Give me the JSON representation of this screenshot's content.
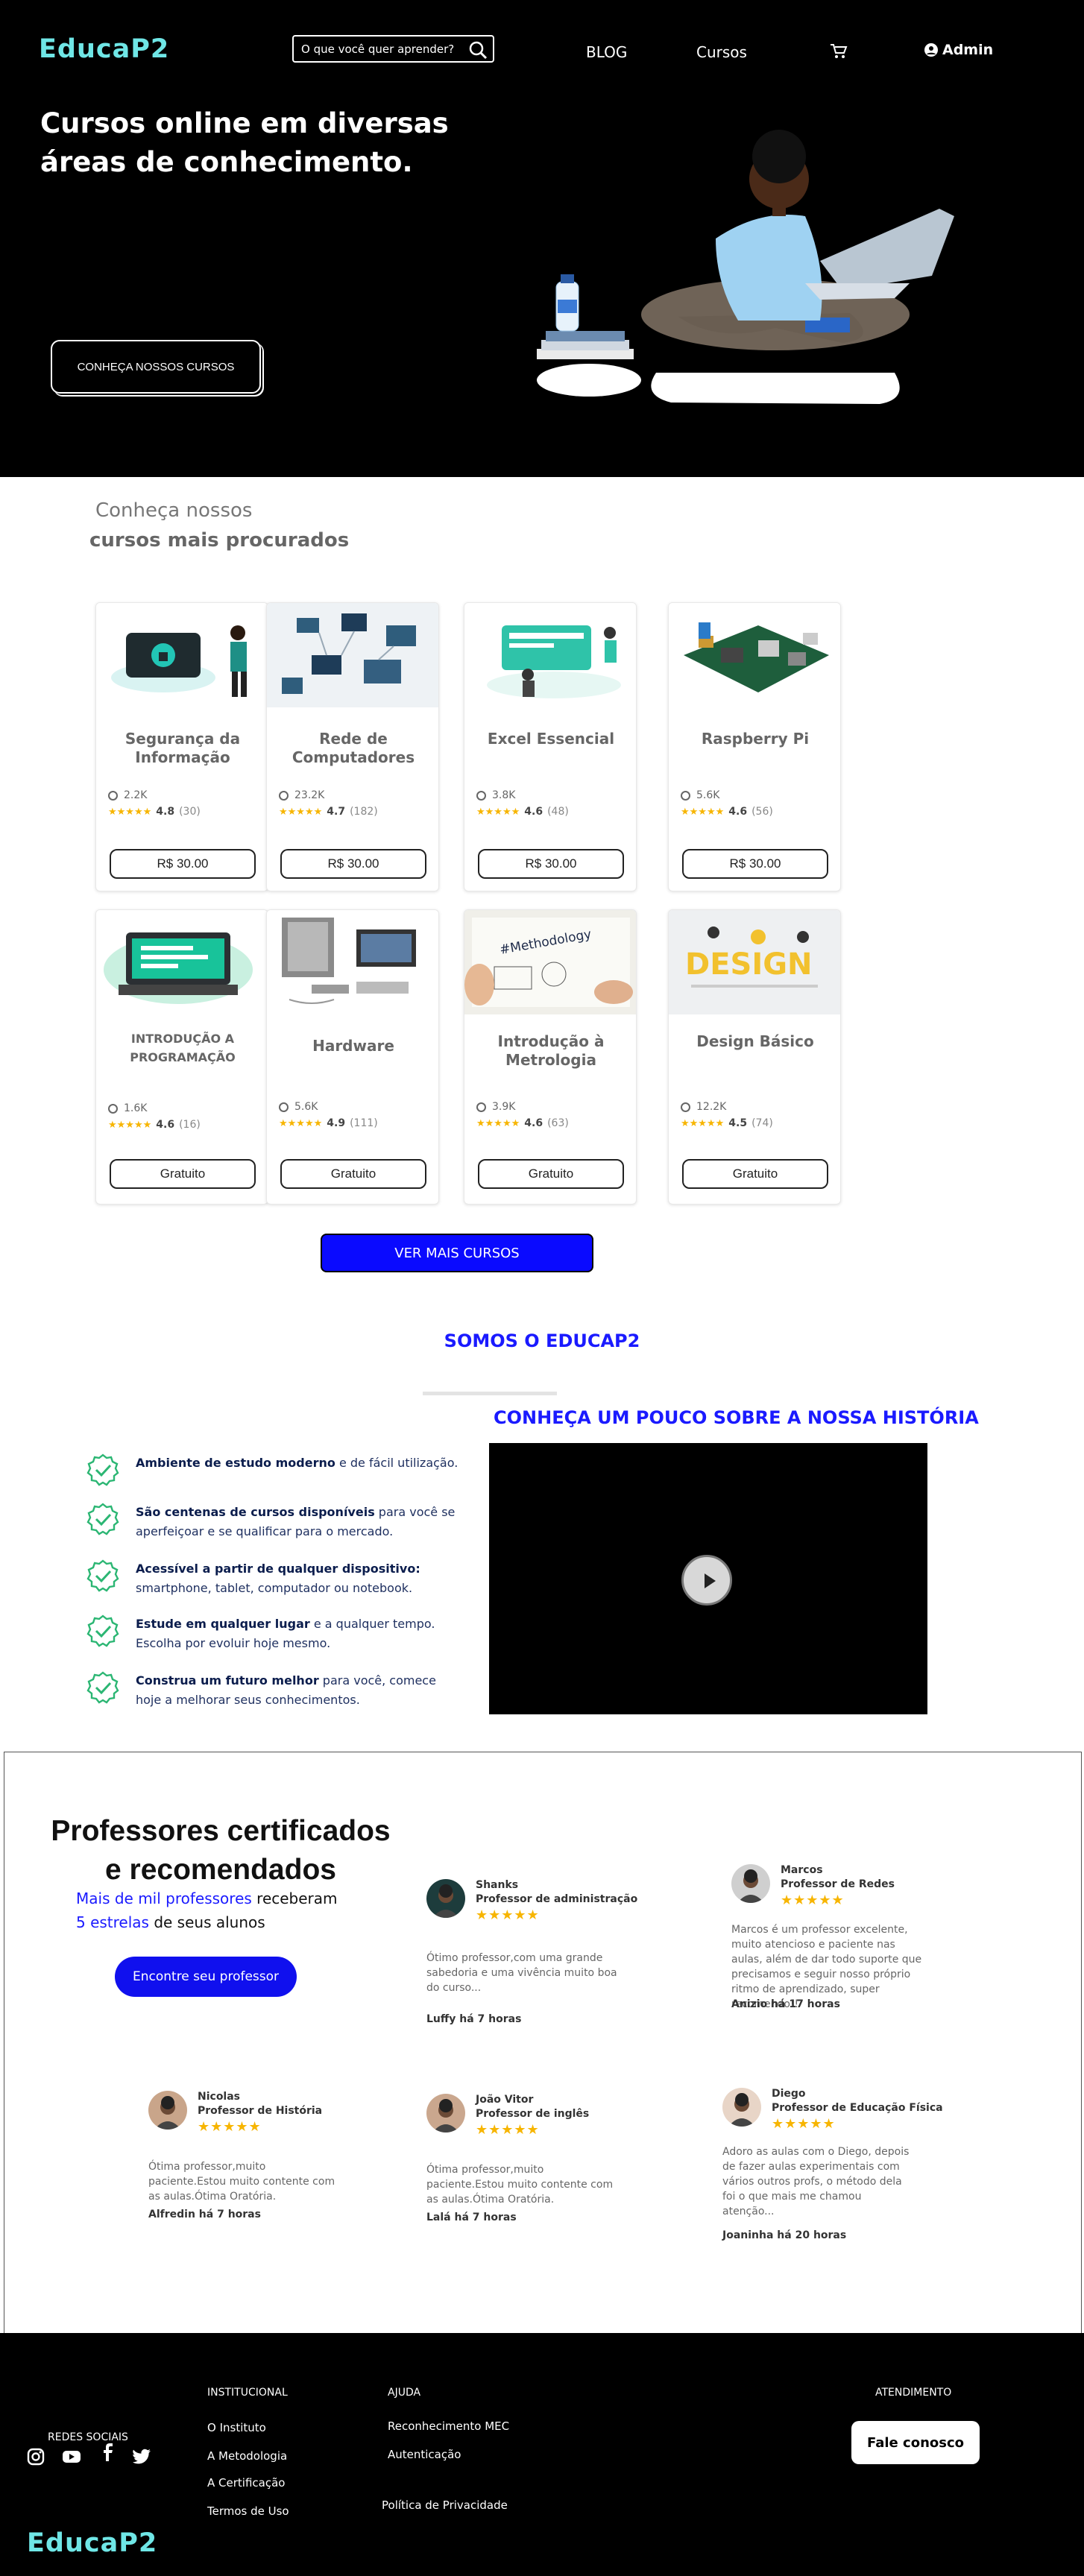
{
  "brand": {
    "name": "EducaP2"
  },
  "header": {
    "search_placeholder": "O que você quer aprender?",
    "nav": {
      "blog": "BLOG",
      "cursos": "Cursos",
      "admin": "Admin"
    },
    "icons": [
      "search-icon",
      "cart-icon",
      "user-icon"
    ]
  },
  "hero": {
    "title": "Cursos online em diversas áreas de conhecimento.",
    "cta": "CONHEÇA NOSSOS CURSOS"
  },
  "courses": {
    "title_line1": "Conheça nossos",
    "title_line2": "cursos mais procurados",
    "items": [
      {
        "title": "Segurança da Informação",
        "students": "2.2K",
        "rating": "4.8",
        "reviews": "(30)",
        "price": "R$ 30.00"
      },
      {
        "title": "Rede de Computadores",
        "students": "23.2K",
        "rating": "4.7",
        "reviews": "(182)",
        "price": "R$ 30.00"
      },
      {
        "title": "Excel Essencial",
        "students": "3.8K",
        "rating": "4.6",
        "reviews": "(48)",
        "price": "R$ 30.00"
      },
      {
        "title": "Raspberry Pi",
        "students": "5.6K",
        "rating": "4.6",
        "reviews": "(56)",
        "price": "R$ 30.00"
      },
      {
        "title": "INTRODUÇÃO A PROGRAMAÇÃO",
        "students": "1.6K",
        "rating": "4.6",
        "reviews": "(16)",
        "price": "Gratuito"
      },
      {
        "title": "Hardware",
        "students": "5.6K",
        "rating": "4.9",
        "reviews": "(111)",
        "price": "Gratuito"
      },
      {
        "title": "Introdução à Metrologia",
        "students": "3.9K",
        "rating": "4.6",
        "reviews": "(63)",
        "price": "Gratuito"
      },
      {
        "title": "Design Básico",
        "students": "12.2K",
        "rating": "4.5",
        "reviews": "(74)",
        "price": "Gratuito"
      }
    ],
    "image_texts": {
      "metrology": "#Methodology",
      "design": "DESIGN"
    },
    "see_more": "VER MAIS CURSOS"
  },
  "about": {
    "title": "SOMOS O EDUCAP2",
    "history_title": "CONHEÇA UM POUCO SOBRE A NOSSA HISTÓRIA",
    "features": [
      {
        "bold": "Ambiente de estudo moderno",
        "rest": " e de fácil utilização."
      },
      {
        "bold": "São centenas de cursos disponíveis",
        "rest": " para você se aperfeiçoar e se qualificar para o mercado."
      },
      {
        "bold": "Acessível a partir de qualquer dispositivo:",
        "rest": " smartphone, tablet, computador ou notebook."
      },
      {
        "bold": "Estude em qualquer lugar",
        "rest": " e a qualquer tempo. Escolha por evoluir hoje mesmo."
      },
      {
        "bold": "Construa um futuro melhor",
        "rest": " para você, comece hoje a melhorar seus conhecimentos."
      }
    ]
  },
  "teachers": {
    "title": "Professores certificados e recomendados",
    "sub_blue1": "Mais de mil professores",
    "sub_rest1": " receberam",
    "sub_blue2": "5 estrelas",
    "sub_rest2": " de seus alunos",
    "cta": "Encontre seu professor",
    "reviews": [
      {
        "name": "Shanks",
        "role": "Professor de administração",
        "stars": "★★★★★",
        "text": "Ótimo professor,com uma grande sabedoria e uma vivência muito boa do curso...",
        "author": "Luffy há 7 horas"
      },
      {
        "name": "Marcos",
        "role": "Professor de Redes",
        "stars": "★★★★★",
        "text": "Marcos é um professor excelente, muito atencioso e paciente nas aulas, além de dar todo suporte que precisamos e seguir nosso próprio ritmo de aprendizado, super recomendo!!",
        "author": "Anizio há 17 horas"
      },
      {
        "name": "Nicolas",
        "role": "Professor de História",
        "stars": "★★★★★",
        "text": "Ótima professor,muito paciente.Estou muito contente com as aulas.Ótima Oratória.",
        "author": "Alfredin há 7 horas"
      },
      {
        "name": "João Vitor",
        "role": "Professor de inglês",
        "stars": "★★★★★",
        "text": "Ótima professor,muito paciente.Estou muito contente com as aulas.Ótima Oratória.",
        "author": "Lalá há 7 horas"
      },
      {
        "name": "Diego",
        "role": "Professor de Educação Física",
        "stars": "★★★★★",
        "text": "Adoro as aulas com o Diego, depois de fazer aulas experimentais com vários outros profs, o método dela foi o que mais me chamou atenção...",
        "author": "Joaninha há 20 horas"
      }
    ]
  },
  "footer": {
    "social_title": "REDES SOCIAIS",
    "social_icons": [
      "instagram-icon",
      "youtube-icon",
      "facebook-icon",
      "twitter-icon"
    ],
    "inst_title": "INSTITUCIONAL",
    "inst_links": [
      "O Instituto",
      "A Metodologia",
      "A Certificação",
      "Termos de Uso"
    ],
    "help_title": "AJUDA",
    "help_links": [
      "Reconhecimento MEC",
      "Autenticação",
      "Política de Privacidade"
    ],
    "support_title": "ATENDIMENTO",
    "contact": "Fale conosco"
  },
  "colors": {
    "accent_blue": "#0a0aff",
    "logo_cyan": "#6fe6e6",
    "star": "#f7b500",
    "check_green": "#2bb673"
  }
}
